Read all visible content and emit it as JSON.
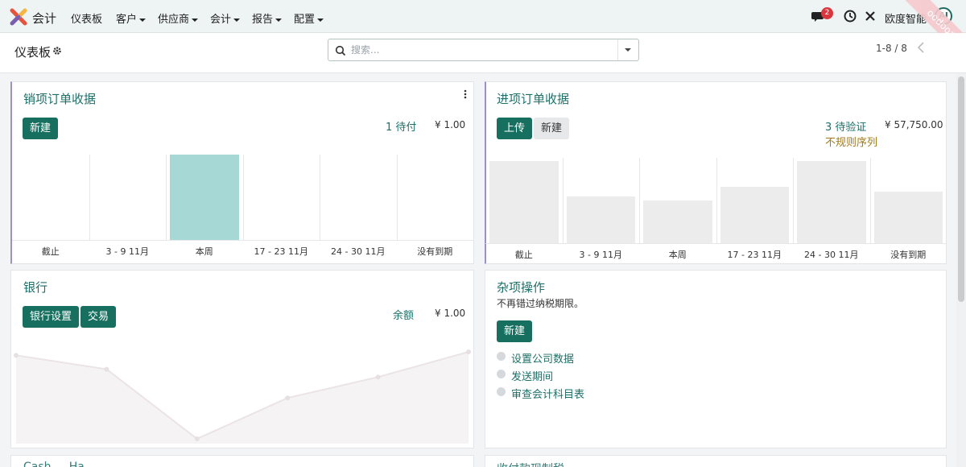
{
  "navbar": {
    "logo_icon": "odoo-x-logo-icon",
    "app_name": "会计",
    "menu": [
      {
        "label": "仪表板",
        "dropdown": false
      },
      {
        "label": "客户",
        "dropdown": true
      },
      {
        "label": "供应商",
        "dropdown": true
      },
      {
        "label": "会计",
        "dropdown": true
      },
      {
        "label": "报告",
        "dropdown": true
      },
      {
        "label": "配置",
        "dropdown": true
      }
    ],
    "messages_badge": "2",
    "company": "欧度智能",
    "avatar_initials": "AI",
    "icons": [
      "chat-icon",
      "clock-icon",
      "tools-icon"
    ]
  },
  "control_panel": {
    "title": "仪表板",
    "search_placeholder": "搜索...",
    "pager": "1-8 / 8"
  },
  "ribbon": {
    "text": "oodooai.cn"
  },
  "colors": {
    "accent": "#17705f",
    "link": "#1d6f68",
    "highlight_bar": "#a6d8d6",
    "gray_bar": "#ececec",
    "card_accent": "#9b8ed9"
  },
  "cards": {
    "sales": {
      "title": "销项订单收据",
      "new_button": "新建",
      "pending_link": "1 待付",
      "amount": "¥ 1.00",
      "chart_data": {
        "type": "bar",
        "categories": [
          "截止",
          "3 - 9 11月",
          "本周",
          "17 - 23 11月",
          "24 - 30 11月",
          "没有到期"
        ],
        "values": [
          0,
          0,
          1,
          0,
          0,
          0
        ],
        "ylim": [
          0,
          1
        ],
        "highlight_index": 2
      }
    },
    "purchase": {
      "title": "进项订单收据",
      "upload_button": "上传",
      "new_button": "新建",
      "verify_link": "3 待验证",
      "amount": "¥ 57,750.00",
      "irregular_label": "不规则序列",
      "chart_data": {
        "type": "bar",
        "categories": [
          "截止",
          "3 - 9 11月",
          "本周",
          "17 - 23 11月",
          "24 - 30 11月",
          "没有到期"
        ],
        "values": [
          96,
          55,
          50,
          66,
          96,
          60
        ],
        "ylim": [
          0,
          100
        ]
      }
    },
    "bank": {
      "title": "银行",
      "settings_button": "银行设置",
      "transactions_button": "交易",
      "balance_link": "余额",
      "amount": "¥ 1.00",
      "chart_data": {
        "type": "area",
        "x": [
          0,
          1,
          2,
          3,
          4,
          5
        ],
        "values": [
          96,
          80,
          0,
          47,
          71,
          100
        ],
        "ylim": [
          0,
          100
        ]
      }
    },
    "misc": {
      "title": "杂项操作",
      "subtitle": "不再错过纳税期限。",
      "new_button": "新建",
      "checklist": [
        "设置公司数据",
        "发送期间",
        "审查会计科目表"
      ]
    },
    "bottom_left_title": "Cash ... Ha...",
    "bottom_right_title": "收付款现制税"
  }
}
